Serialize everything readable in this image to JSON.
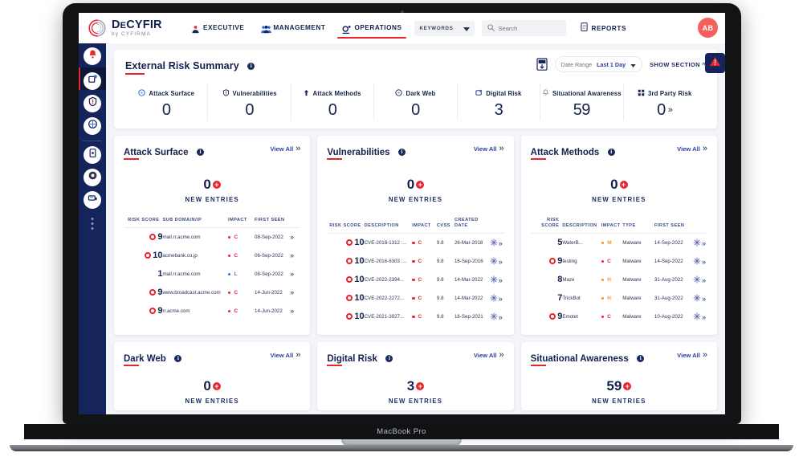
{
  "device": {
    "label": "MacBook Pro"
  },
  "nav": {
    "brand": {
      "title_a": "D",
      "title_b": "E",
      "title_c": "CYFIR",
      "sub": "by CYFIRMA"
    },
    "items": [
      {
        "label": "EXECUTIVE",
        "icon": "executive-icon",
        "active": false
      },
      {
        "label": "MANAGEMENT",
        "icon": "management-icon",
        "active": false
      },
      {
        "label": "OPERATIONS",
        "icon": "operations-icon",
        "active": true
      }
    ],
    "keywords": {
      "label": "KEYWORDS",
      "icon": "chevron-down-icon"
    },
    "search": {
      "placeholder": "Search",
      "value": "",
      "icon": "search-icon"
    },
    "reports": {
      "label": "REPORTS",
      "icon": "report-icon"
    },
    "avatar": {
      "initials": "AB"
    }
  },
  "rail": {
    "items": [
      {
        "name": "alerts-icon",
        "selected": false
      },
      {
        "name": "attack-surface-icon",
        "selected": true
      },
      {
        "name": "vulnerabilities-icon",
        "selected": false
      },
      {
        "name": "dark-web-icon",
        "selected": false
      },
      {
        "name": "digital-risk-icon",
        "selected": false
      },
      {
        "name": "situational-awareness-icon",
        "selected": false
      },
      {
        "name": "third-party-risk-icon",
        "selected": false
      }
    ]
  },
  "summary": {
    "title": "External Risk Summary",
    "info": "i",
    "export_icon": "pdf-export-icon",
    "date_range": {
      "label": "Date Range",
      "value": "Last 1 Day",
      "icon": "chevron-down-icon"
    },
    "show_section": "SHOW SECTION",
    "show_section_icon": "chevron-up-icon",
    "alert_icon": "warning-triangle-icon",
    "kpis": [
      {
        "label": "Attack Surface",
        "value": "0",
        "icon": "globe-icon",
        "chevron": ""
      },
      {
        "label": "Vulnerabilities",
        "value": "0",
        "icon": "shield-alert-icon",
        "chevron": ""
      },
      {
        "label": "Attack Methods",
        "value": "0",
        "icon": "arrow-up-icon",
        "chevron": ""
      },
      {
        "label": "Dark Web",
        "value": "0",
        "icon": "dark-web-icon",
        "chevron": ""
      },
      {
        "label": "Digital Risk",
        "value": "3",
        "icon": "digital-risk-icon",
        "chevron": ""
      },
      {
        "label": "Situational Awareness",
        "value": "59",
        "icon": "alert-bell-icon",
        "chevron": ""
      },
      {
        "label": "3rd Party Risk",
        "value": "0",
        "icon": "grid-squares-icon",
        "chevron": "»"
      }
    ]
  },
  "cards": {
    "attack_surface": {
      "title": "Attack Surface",
      "info": "i",
      "view_all": "View All",
      "new_count": "0",
      "new_label": "NEW ENTRIES",
      "columns": [
        "RISK SCORE",
        "SUB DOMAIN/IP",
        "IMPACT",
        "FIRST SEEN"
      ],
      "rows": [
        {
          "score": "9",
          "ring": true,
          "desc": "mail.rr.acme.com",
          "impact": "C",
          "impact_color": "#e8262d",
          "date": "08-Sep-2022"
        },
        {
          "score": "10",
          "ring": true,
          "desc": "acmebank.co.jp",
          "impact": "C",
          "impact_color": "#e8262d",
          "date": "06-Sep-2022"
        },
        {
          "score": "1",
          "ring": false,
          "desc": "mail.rr.acme.com",
          "impact": "L",
          "impact_color": "#2b6fe0",
          "date": "08-Sep-2022"
        },
        {
          "score": "9",
          "ring": true,
          "desc": "www.broadcast.acme.com",
          "impact": "C",
          "impact_color": "#e8262d",
          "date": "14-Jun-2022"
        },
        {
          "score": "9",
          "ring": true,
          "desc": "rr.acme.com",
          "impact": "C",
          "impact_color": "#e8262d",
          "date": "14-Jun-2022"
        }
      ]
    },
    "vulnerabilities": {
      "title": "Vulnerabilities",
      "info": "i",
      "view_all": "View All",
      "new_count": "0",
      "new_label": "NEW ENTRIES",
      "columns": [
        "RISK SCORE",
        "DESCRIPTION",
        "IMPACT",
        "CVSS",
        "CREATED DATE"
      ],
      "rows": [
        {
          "score": "10",
          "ring": true,
          "desc": "CVE-2018-1312 :...",
          "impact": "C",
          "impact_color": "#e8262d",
          "cvss": "9.8",
          "date": "26-Mar-2018"
        },
        {
          "score": "10",
          "ring": true,
          "desc": "CVE-2016-6303 :...",
          "impact": "C",
          "impact_color": "#e8262d",
          "cvss": "9.8",
          "date": "16-Sep-2016"
        },
        {
          "score": "10",
          "ring": true,
          "desc": "CVE-2022-2394...",
          "impact": "C",
          "impact_color": "#e8262d",
          "cvss": "9.8",
          "date": "14-Mar-2022"
        },
        {
          "score": "10",
          "ring": true,
          "desc": "CVE-2022-2272...",
          "impact": "C",
          "impact_color": "#e8262d",
          "cvss": "9.8",
          "date": "14-Mar-2022"
        },
        {
          "score": "10",
          "ring": true,
          "desc": "CVE-2021-3927...",
          "impact": "C",
          "impact_color": "#e8262d",
          "cvss": "9.8",
          "date": "16-Sep-2021"
        }
      ]
    },
    "attack_methods": {
      "title": "Attack Methods",
      "info": "i",
      "view_all": "View All",
      "new_count": "0",
      "new_label": "NEW ENTRIES",
      "columns": [
        "RISK SCORE",
        "DESCRIPTION",
        "IMPACT",
        "TYPE",
        "FIRST SEEN"
      ],
      "rows": [
        {
          "score": "5",
          "ring": false,
          "desc": "WaterB...",
          "impact": "M",
          "impact_color": "#f0962a",
          "type": "Malware",
          "date": "14-Sep-2022"
        },
        {
          "score": "9",
          "ring": true,
          "desc": "testing",
          "impact": "C",
          "impact_color": "#e8262d",
          "type": "Malware",
          "date": "14-Sep-2022"
        },
        {
          "score": "8",
          "ring": false,
          "desc": "Maze",
          "impact": "H",
          "impact_color": "#f0962a",
          "type": "Malware",
          "date": "31-Aug-2022"
        },
        {
          "score": "7",
          "ring": false,
          "desc": "TrickBot",
          "impact": "H",
          "impact_color": "#f0962a",
          "type": "Malware",
          "date": "31-Aug-2022"
        },
        {
          "score": "9",
          "ring": true,
          "desc": "Emotet",
          "impact": "C",
          "impact_color": "#e8262d",
          "type": "Malware",
          "date": "10-Aug-2022"
        }
      ]
    },
    "dark_web": {
      "title": "Dark Web",
      "info": "i",
      "view_all": "View All",
      "new_count": "0",
      "new_label": "NEW ENTRIES"
    },
    "digital_risk": {
      "title": "Digital Risk",
      "info": "i",
      "view_all": "View All",
      "new_count": "3",
      "new_label": "NEW ENTRIES"
    },
    "situational_awareness": {
      "title": "Situational Awareness",
      "info": "i",
      "view_all": "View All",
      "new_count": "59",
      "new_label": "NEW ENTRIES"
    }
  },
  "colors": {
    "navy": "#14204d",
    "rail": "#16245c",
    "accent_red": "#e8262d",
    "link_blue": "#2b3f9c",
    "page_bg": "#f4f5f8",
    "avatar": "#f4605c",
    "orange": "#f0962a"
  }
}
